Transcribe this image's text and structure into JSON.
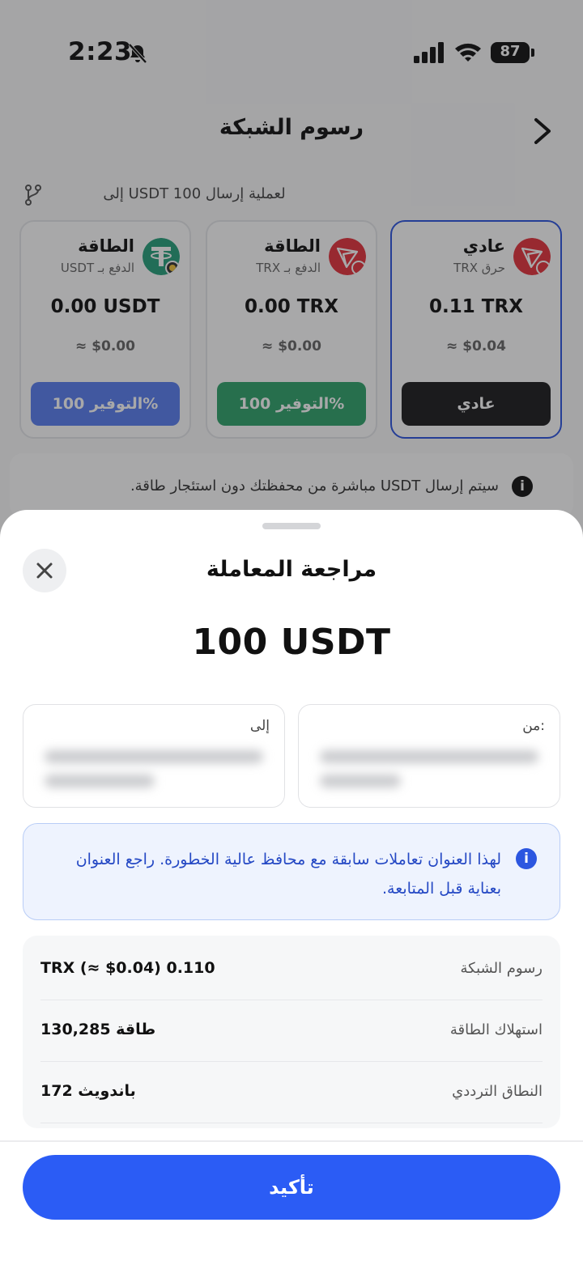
{
  "status_bar": {
    "time": "2:23",
    "battery": "87"
  },
  "header": {
    "title": "رسوم الشبكة"
  },
  "subtitle": "لعملية إرسال USDT 100 إلى",
  "fee_options": [
    {
      "name": "عادي",
      "sub": "حرق TRX",
      "amount": "0.11 TRX",
      "usd": "≈ $0.04",
      "button": "عادي",
      "button_color": "#1c1c1e",
      "selected": true
    },
    {
      "name": "الطاقة",
      "sub": "الدفع بـ TRX",
      "amount": "0.00 TRX",
      "usd": "≈ $0.00",
      "button": "التوفير 100%",
      "button_color": "#2fa36b",
      "selected": false
    },
    {
      "name": "الطاقة",
      "sub": "الدفع بـ USDT",
      "amount": "0.00 USDT",
      "usd": "≈ $0.00",
      "button": "التوفير 100%",
      "button_color": "#5a7ff0",
      "selected": false
    }
  ],
  "info_note": "سيتم إرسال USDT مباشرة من محفظتك دون استئجار طاقة.",
  "sheet": {
    "title": "مراجعة المعاملة",
    "amount": "100 USDT",
    "from_label": "من:",
    "to_label": "إلى",
    "warning": "لهذا العنوان تعاملات سابقة مع محافظ عالية الخطورة. راجع العنوان بعناية قبل المتابعة.",
    "details": [
      {
        "label": "رسوم الشبكة",
        "value": "TRX (≈ $0.04) 0.110"
      },
      {
        "label": "استهلاك الطاقة",
        "value": "130,285 طاقة"
      },
      {
        "label": "النطاق الترددي",
        "value": "172 باندويث"
      }
    ],
    "confirm_label": "تأكيد"
  },
  "colors": {
    "accent": "#2b5cf5",
    "tron_red": "#e5333d",
    "tether_green": "#26a17b"
  }
}
